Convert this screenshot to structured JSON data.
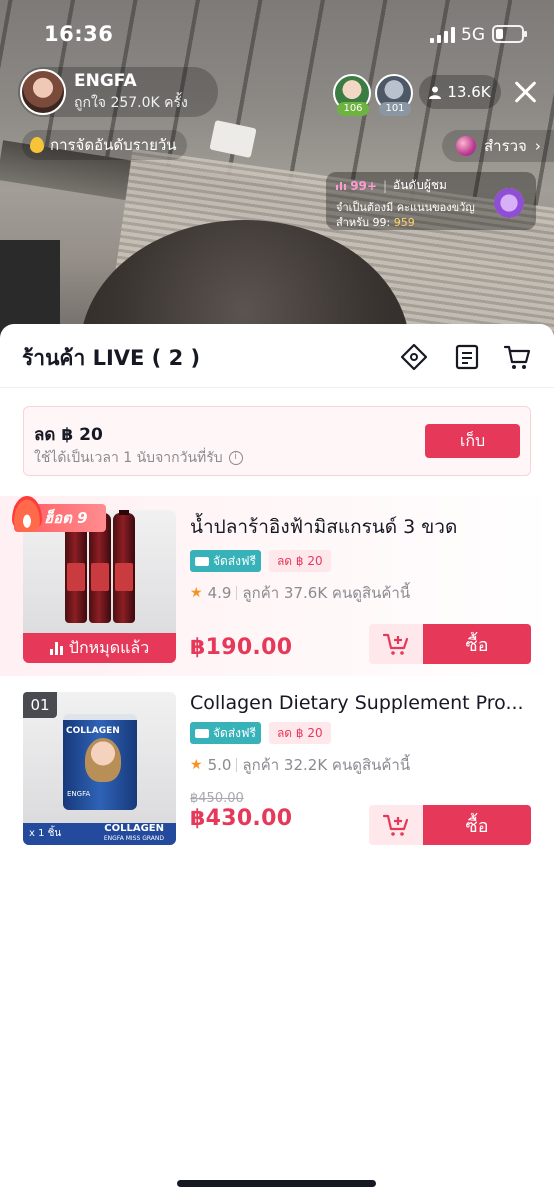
{
  "status_bar": {
    "time": "16:36",
    "network": "5G",
    "battery_level": 0.3
  },
  "live": {
    "host_name": "ENGFA",
    "host_likes": "ถูกใจ 257.0K ครั้ง",
    "top_viewers": [
      {
        "rank": "106"
      },
      {
        "rank": "101"
      }
    ],
    "viewer_count": "13.6K",
    "daily_rank_label": "การจัดอันดับรายวัน",
    "explore_label": "สำรวจ",
    "leaderboard": {
      "rank": "99+",
      "title": "อันดับผู้ชม",
      "note": "จำเป็นต้องมี คะแนนของขวัญ สำหรับ 99:",
      "points": "959"
    }
  },
  "shop": {
    "title": "ร้านค้า LIVE ( 2 )",
    "coupon": {
      "amount": "ลด ฿ 20",
      "note": "ใช้ได้เป็นเวลา 1 นับจากวันที่รับ",
      "claim_label": "เก็บ"
    },
    "products": [
      {
        "hot_label": "ฮ็อต 9",
        "name": "น้ำปลาร้าอิงฟ้ามิสแกรนด์ 3 ขวด",
        "free_ship": "จัดส่งฟรี",
        "discount": "ลด ฿ 20",
        "rating": "4.9",
        "buyers": "ลูกค้า 37.6K คนดูสินค้านี้",
        "sold_out_label": "ปักหมุดแล้ว",
        "price": "฿190.00",
        "buy_label": "ซื้อ"
      },
      {
        "index": "01",
        "name": "Collagen Dietary Supplement Pro...",
        "free_ship": "จัดส่งฟรี",
        "discount": "ลด ฿ 20",
        "rating": "5.0",
        "buyers": "ลูกค้า 32.2K คนดูสินค้านี้",
        "original_price": "฿450.00",
        "price": "฿430.00",
        "buy_label": "ซื้อ",
        "thumb_title": "COLLAGEN",
        "thumb_brand": "ENGFA",
        "thumb_band": "COLLAGEN",
        "thumb_band_sub": "ENGFA MISS GRAND",
        "thumb_qty": "x 1 ชิ้น"
      }
    ]
  },
  "colors": {
    "accent": "#e6395a",
    "ship_tag": "#38b2b9",
    "star": "#f79325"
  }
}
